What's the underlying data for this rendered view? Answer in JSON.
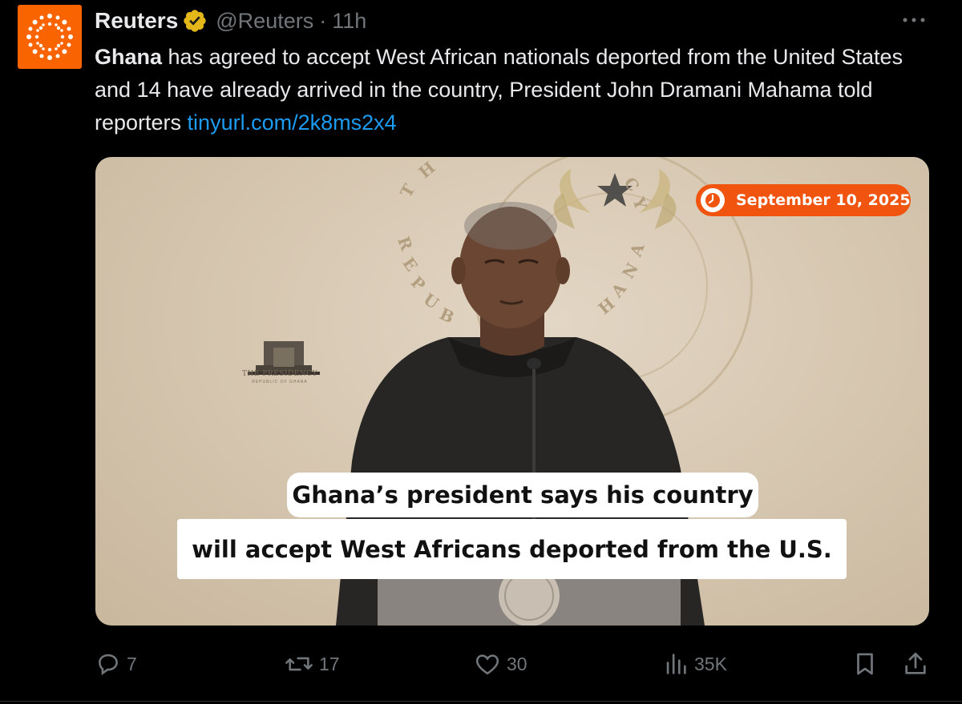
{
  "author": {
    "display_name": "Reuters",
    "handle": "@Reuters",
    "time_ago": "11h",
    "verified_badge": "gold-verified-badge",
    "avatar": "reuters-logo",
    "avatar_color": "#fa6400"
  },
  "tweet": {
    "text_bold": "Ghana",
    "text_body": " has agreed to accept West African nationals deported from the United States and 14 have already arrived in the country, President John Dramani Mahama told reporters ",
    "link": "tinyurl.com/2k8ms2x4"
  },
  "media": {
    "date_badge": "September 10, 2025",
    "caption_line1": "Ghana’s president says his country",
    "caption_line2": "will accept West Africans deported from the U.S.",
    "badge_color": "#f0540f"
  },
  "actions": {
    "replies": "7",
    "reposts": "17",
    "likes": "30",
    "views": "35K",
    "icons": [
      "reply-icon",
      "repost-icon",
      "like-icon",
      "views-icon",
      "bookmark-icon",
      "share-icon"
    ]
  },
  "colors": {
    "background": "#000000",
    "text": "#e7e9ea",
    "muted": "#71767b",
    "link": "#1d9bf0"
  }
}
